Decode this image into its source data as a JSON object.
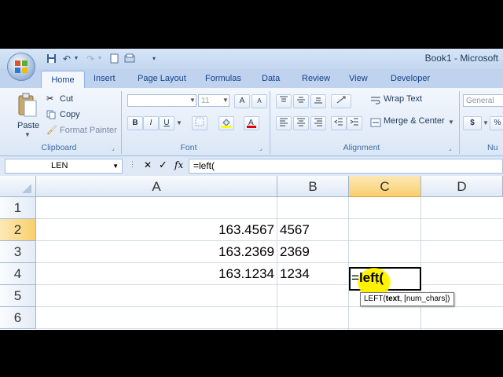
{
  "window": {
    "title": "Book1 - Microsoft"
  },
  "tabs": [
    "Home",
    "Insert",
    "Page Layout",
    "Formulas",
    "Data",
    "Review",
    "View",
    "Developer"
  ],
  "clipboard": {
    "paste": "Paste",
    "cut": "Cut",
    "copy": "Copy",
    "format_painter": "Format Painter",
    "group": "Clipboard"
  },
  "font": {
    "size": "11",
    "group": "Font",
    "bold": "B",
    "italic": "I",
    "underline": "U",
    "grow": "A",
    "shrink": "A"
  },
  "alignment": {
    "wrap_text": "Wrap Text",
    "merge_center": "Merge & Center",
    "group": "Alignment"
  },
  "number": {
    "format": "General",
    "currency": "$",
    "percent": "%",
    "group": "Nu"
  },
  "formula_bar": {
    "name_box": "LEN",
    "cancel": "✕",
    "enter": "✓",
    "fx": "fx",
    "content": "=left("
  },
  "columns": [
    "A",
    "B",
    "C",
    "D"
  ],
  "rows": [
    "1",
    "2",
    "3",
    "4",
    "5",
    "6"
  ],
  "cells": {
    "A2": "163.4567",
    "B2": "4567",
    "A3": "163.2369",
    "B3": "2369",
    "A4": "163.1234",
    "B4": "1234"
  },
  "edit_cell": {
    "ref": "C2",
    "prefix": "=",
    "text": "left("
  },
  "tooltip": {
    "fn": "LEFT(",
    "arg": "text",
    "rest": ", [num_chars])"
  }
}
